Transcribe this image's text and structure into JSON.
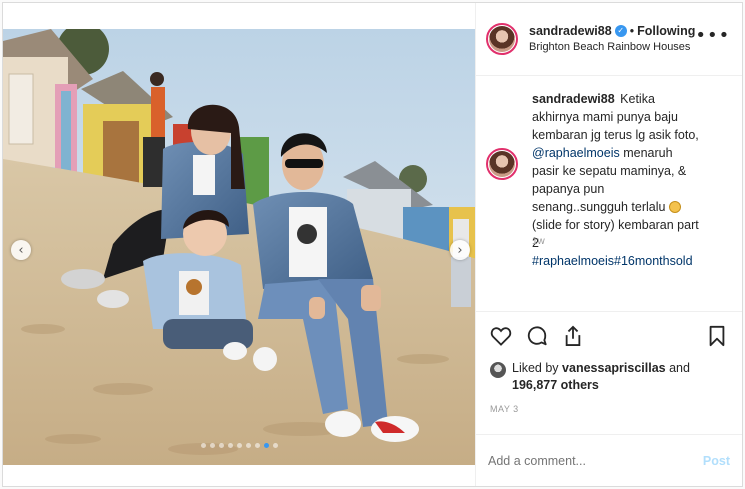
{
  "header": {
    "username": "sandradewi88",
    "verified_mark": "✓",
    "separator": "•",
    "follow_status": "Following",
    "location": "Brighton Beach Rainbow Houses",
    "more_icon": "more-horizontal-icon"
  },
  "caption": {
    "username": "sandradewi88",
    "text_1": "Ketika akhirnya mami punya baju kembaran jg terus lg asik foto,",
    "mention_1": "@raphaelmoeis",
    "text_2": "menaruh pasir ke sepatu maminya, & papanya pun senang..sungguh terlalu",
    "text_3": "(slide for story) kembaran part 2",
    "hashtag_1": "#raphaelmoeis",
    "hashtag_2": "#16monthsold",
    "time_ago": "1w"
  },
  "media": {
    "prev_arrow": "‹",
    "next_arrow": "›",
    "slide_count": 9,
    "active_slide": 8
  },
  "actions": {
    "like_icon": "heart-icon",
    "comment_icon": "comment-icon",
    "share_icon": "share-icon",
    "save_icon": "bookmark-icon"
  },
  "likes": {
    "prefix": "Liked by",
    "user": "vanessapriscillas",
    "conj": "and",
    "count": "196,877 others"
  },
  "date": "MAY 3",
  "comment": {
    "placeholder": "Add a comment...",
    "post_label": "Post"
  },
  "colors": {
    "accent": "#3897f0",
    "story_ring": "#e1306c",
    "mention": "#003569",
    "post_disabled": "#b2dffc"
  }
}
